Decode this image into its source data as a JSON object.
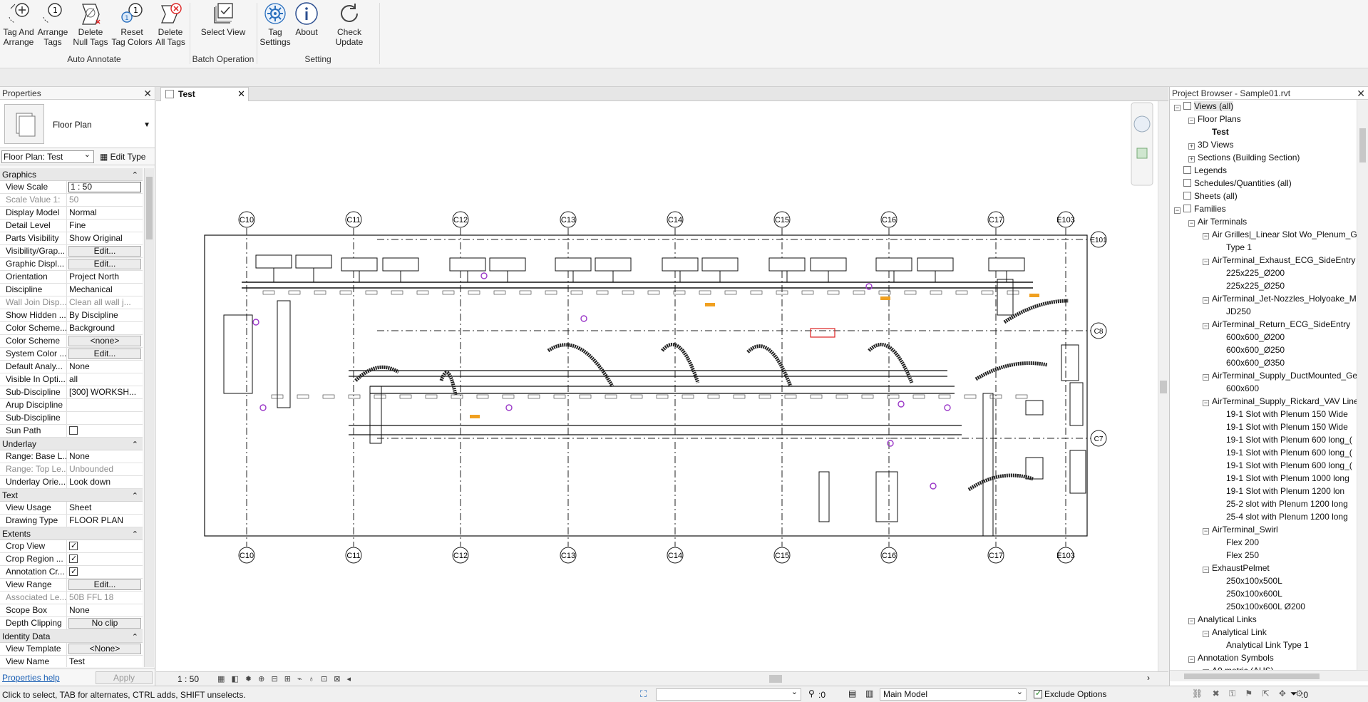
{
  "ribbon": {
    "buttons": [
      {
        "label_1": "Tag And",
        "label_2": "Arrange",
        "icon": "tag-and-arrange-icon"
      },
      {
        "label_1": "Arrange",
        "label_2": "Tags",
        "icon": "arrange-tags-icon"
      },
      {
        "label_1": "Delete",
        "label_2": "Null Tags",
        "icon": "delete-null-tags-icon"
      },
      {
        "label_1": "Reset",
        "label_2": "Tag Colors",
        "icon": "reset-tag-colors-icon"
      },
      {
        "label_1": "Delete",
        "label_2": "All Tags",
        "icon": "delete-all-tags-icon"
      },
      {
        "label_1": "Select View",
        "label_2": "",
        "icon": "select-view-icon"
      },
      {
        "label_1": "Tag",
        "label_2": "Settings",
        "icon": "gear-icon"
      },
      {
        "label_1": "About",
        "label_2": "",
        "icon": "info-icon"
      },
      {
        "label_1": "Check Update",
        "label_2": "",
        "icon": "refresh-icon"
      }
    ],
    "groups": [
      "Auto Annotate",
      "Batch Operation",
      "Setting"
    ]
  },
  "properties": {
    "title": "Properties",
    "type_name": "Floor Plan",
    "instance_selector": "Floor Plan: Test",
    "edit_type": "Edit Type",
    "sections": [
      {
        "header": "Graphics",
        "rows": [
          {
            "k": "View Scale",
            "v": "1 : 50",
            "kind": "input"
          },
          {
            "k": "Scale Value    1:",
            "v": "50",
            "kind": "dim"
          },
          {
            "k": "Display Model",
            "v": "Normal"
          },
          {
            "k": "Detail Level",
            "v": "Fine"
          },
          {
            "k": "Parts Visibility",
            "v": "Show Original"
          },
          {
            "k": "Visibility/Grap...",
            "v": "Edit...",
            "kind": "button"
          },
          {
            "k": "Graphic Displ...",
            "v": "Edit...",
            "kind": "button"
          },
          {
            "k": "Orientation",
            "v": "Project North"
          },
          {
            "k": "Discipline",
            "v": "Mechanical"
          },
          {
            "k": "Wall Join Disp...",
            "v": "Clean all wall j...",
            "kind": "dim"
          },
          {
            "k": "Show Hidden ...",
            "v": "By Discipline"
          },
          {
            "k": "Color Scheme...",
            "v": "Background"
          },
          {
            "k": "Color Scheme",
            "v": "<none>",
            "kind": "button"
          },
          {
            "k": "System Color ...",
            "v": "Edit...",
            "kind": "button"
          },
          {
            "k": "Default Analy...",
            "v": "None"
          },
          {
            "k": "Visible In Opti...",
            "v": "all"
          },
          {
            "k": "Sub-Discipline",
            "v": "[300] WORKSH..."
          },
          {
            "k": "Arup Discipline",
            "v": ""
          },
          {
            "k": "Sub-Discipline",
            "v": ""
          },
          {
            "k": "Sun Path",
            "v": "",
            "kind": "check_off"
          }
        ]
      },
      {
        "header": "Underlay",
        "rows": [
          {
            "k": "Range: Base L...",
            "v": "None"
          },
          {
            "k": "Range: Top Le...",
            "v": "Unbounded",
            "kind": "dim"
          },
          {
            "k": "Underlay Orie...",
            "v": "Look down"
          }
        ]
      },
      {
        "header": "Text",
        "rows": [
          {
            "k": "View Usage",
            "v": "Sheet"
          },
          {
            "k": "Drawing Type",
            "v": "FLOOR PLAN"
          }
        ]
      },
      {
        "header": "Extents",
        "rows": [
          {
            "k": "Crop View",
            "v": "",
            "kind": "check_on"
          },
          {
            "k": "Crop Region ...",
            "v": "",
            "kind": "check_on"
          },
          {
            "k": "Annotation Cr...",
            "v": "",
            "kind": "check_on"
          },
          {
            "k": "View Range",
            "v": "Edit...",
            "kind": "button"
          },
          {
            "k": "Associated Le...",
            "v": "50B FFL 18",
            "kind": "dim"
          },
          {
            "k": "Scope Box",
            "v": "None"
          },
          {
            "k": "Depth Clipping",
            "v": "No clip",
            "kind": "button"
          }
        ]
      },
      {
        "header": "Identity Data",
        "rows": [
          {
            "k": "View Template",
            "v": "<None>",
            "kind": "button"
          },
          {
            "k": "View Name",
            "v": "Test"
          }
        ]
      }
    ],
    "help_link": "Properties help",
    "apply": "Apply"
  },
  "view": {
    "tab_label": "Test",
    "scale_label": "1 : 50",
    "grid_top": [
      "C10",
      "C11",
      "C12",
      "C13",
      "C14",
      "C15",
      "C16",
      "C17",
      "E103"
    ],
    "grid_bottom": [
      "C10",
      "C11",
      "C12",
      "C13",
      "C14",
      "C15",
      "C16",
      "C17",
      "E103"
    ],
    "grid_right": [
      "E101",
      "C8",
      "C7"
    ]
  },
  "browser": {
    "title": "Project Browser - Sample01.rvt",
    "tree": [
      {
        "label": "Views (all)",
        "level": 0,
        "tog": "-",
        "icon": true,
        "sel": true
      },
      {
        "label": "Floor Plans",
        "level": 1,
        "tog": "-"
      },
      {
        "label": "Test",
        "level": 2,
        "bold": true
      },
      {
        "label": "3D Views",
        "level": 1,
        "tog": "+"
      },
      {
        "label": "Sections (Building Section)",
        "level": 1,
        "tog": "+"
      },
      {
        "label": "Legends",
        "level": 0,
        "icon": true
      },
      {
        "label": "Schedules/Quantities (all)",
        "level": 0,
        "icon": true
      },
      {
        "label": "Sheets (all)",
        "level": 0,
        "icon": true
      },
      {
        "label": "Families",
        "level": 0,
        "tog": "-",
        "icon": true
      },
      {
        "label": "Air Terminals",
        "level": 1,
        "tog": "-"
      },
      {
        "label": "Air Grilles|_Linear Slot Wo_Plenum_Ge",
        "level": 2,
        "tog": "-"
      },
      {
        "label": "Type 1",
        "level": 3
      },
      {
        "label": "AirTerminal_Exhaust_ECG_SideEntry",
        "level": 2,
        "tog": "-"
      },
      {
        "label": "225x225_Ø200",
        "level": 3
      },
      {
        "label": "225x225_Ø250",
        "level": 3
      },
      {
        "label": "AirTerminal_Jet-Nozzles_Holyoake_MI",
        "level": 2,
        "tog": "-"
      },
      {
        "label": "JD250",
        "level": 3
      },
      {
        "label": "AirTerminal_Return_ECG_SideEntry",
        "level": 2,
        "tog": "-"
      },
      {
        "label": "600x600_Ø200",
        "level": 3
      },
      {
        "label": "600x600_Ø250",
        "level": 3
      },
      {
        "label": "600x600_Ø350",
        "level": 3
      },
      {
        "label": "AirTerminal_Supply_DuctMounted_Ge",
        "level": 2,
        "tog": "-"
      },
      {
        "label": "600x600",
        "level": 3
      },
      {
        "label": "AirTerminal_Supply_Rickard_VAV Linea",
        "level": 2,
        "tog": "-"
      },
      {
        "label": "19-1 Slot with Plenum 150 Wide",
        "level": 3
      },
      {
        "label": "19-1 Slot with Plenum 150 Wide",
        "level": 3
      },
      {
        "label": "19-1 Slot with Plenum 600 long_(",
        "level": 3
      },
      {
        "label": "19-1 Slot with Plenum 600 long_(",
        "level": 3
      },
      {
        "label": "19-1 Slot with Plenum 600 long_(",
        "level": 3
      },
      {
        "label": "19-1 Slot with Plenum 1000 long",
        "level": 3
      },
      {
        "label": "19-1 Slot with Plenum 1200 lon",
        "level": 3
      },
      {
        "label": "25-2 slot with Plenum 1200 long",
        "level": 3
      },
      {
        "label": "25-4 slot with Plenum 1200 long",
        "level": 3
      },
      {
        "label": "AirTerminal_Swirl",
        "level": 2,
        "tog": "-"
      },
      {
        "label": "Flex 200",
        "level": 3
      },
      {
        "label": "Flex 250",
        "level": 3
      },
      {
        "label": "ExhaustPelmet",
        "level": 2,
        "tog": "-"
      },
      {
        "label": "250x100x500L",
        "level": 3
      },
      {
        "label": "250x100x600L",
        "level": 3
      },
      {
        "label": "250x100x600L Ø200",
        "level": 3
      },
      {
        "label": "Analytical Links",
        "level": 1,
        "tog": "-"
      },
      {
        "label": "Analytical Link",
        "level": 2,
        "tog": "-"
      },
      {
        "label": "Analytical Link Type 1",
        "level": 3
      },
      {
        "label": "Annotation Symbols",
        "level": 1,
        "tog": "-"
      },
      {
        "label": "A0 metric (AUS)",
        "level": 2,
        "tog": "-"
      }
    ]
  },
  "status": {
    "message": "Click to select, TAB for alternates, CTRL adds, SHIFT unselects.",
    "zero_count": ":0",
    "model": "Main Model",
    "exclude": "Exclude Options",
    "filter": ":0"
  }
}
